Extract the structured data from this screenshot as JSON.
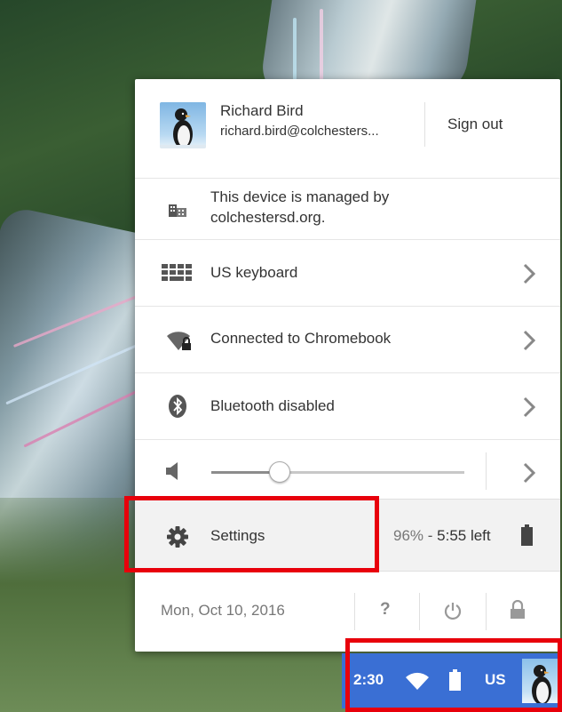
{
  "user": {
    "name": "Richard Bird",
    "email": "richard.bird@colchesters...",
    "sign_out_label": "Sign out"
  },
  "managed": {
    "line1": "This device is managed by",
    "line2": "colchestersd.org."
  },
  "items": [
    {
      "label": "US keyboard",
      "icon": "keyboard-icon"
    },
    {
      "label": "Connected to Chromebook",
      "icon": "wifi-lock-icon"
    },
    {
      "label": "Bluetooth disabled",
      "icon": "bluetooth-icon"
    }
  ],
  "volume": {
    "level": 0.27,
    "icon": "speaker-icon"
  },
  "settings": {
    "label": "Settings",
    "battery_percent": "96%",
    "battery_separator": " - ",
    "battery_time": "5:55 left"
  },
  "footer": {
    "date": "Mon, Oct 10, 2016",
    "help_label": "?"
  },
  "shelf": {
    "time": "2:30",
    "ime": "US"
  },
  "colors": {
    "highlight": "#e8000b",
    "shelf": "#3a6fd4",
    "slider_fill": "#8c8c8c",
    "icon": "#555555"
  }
}
